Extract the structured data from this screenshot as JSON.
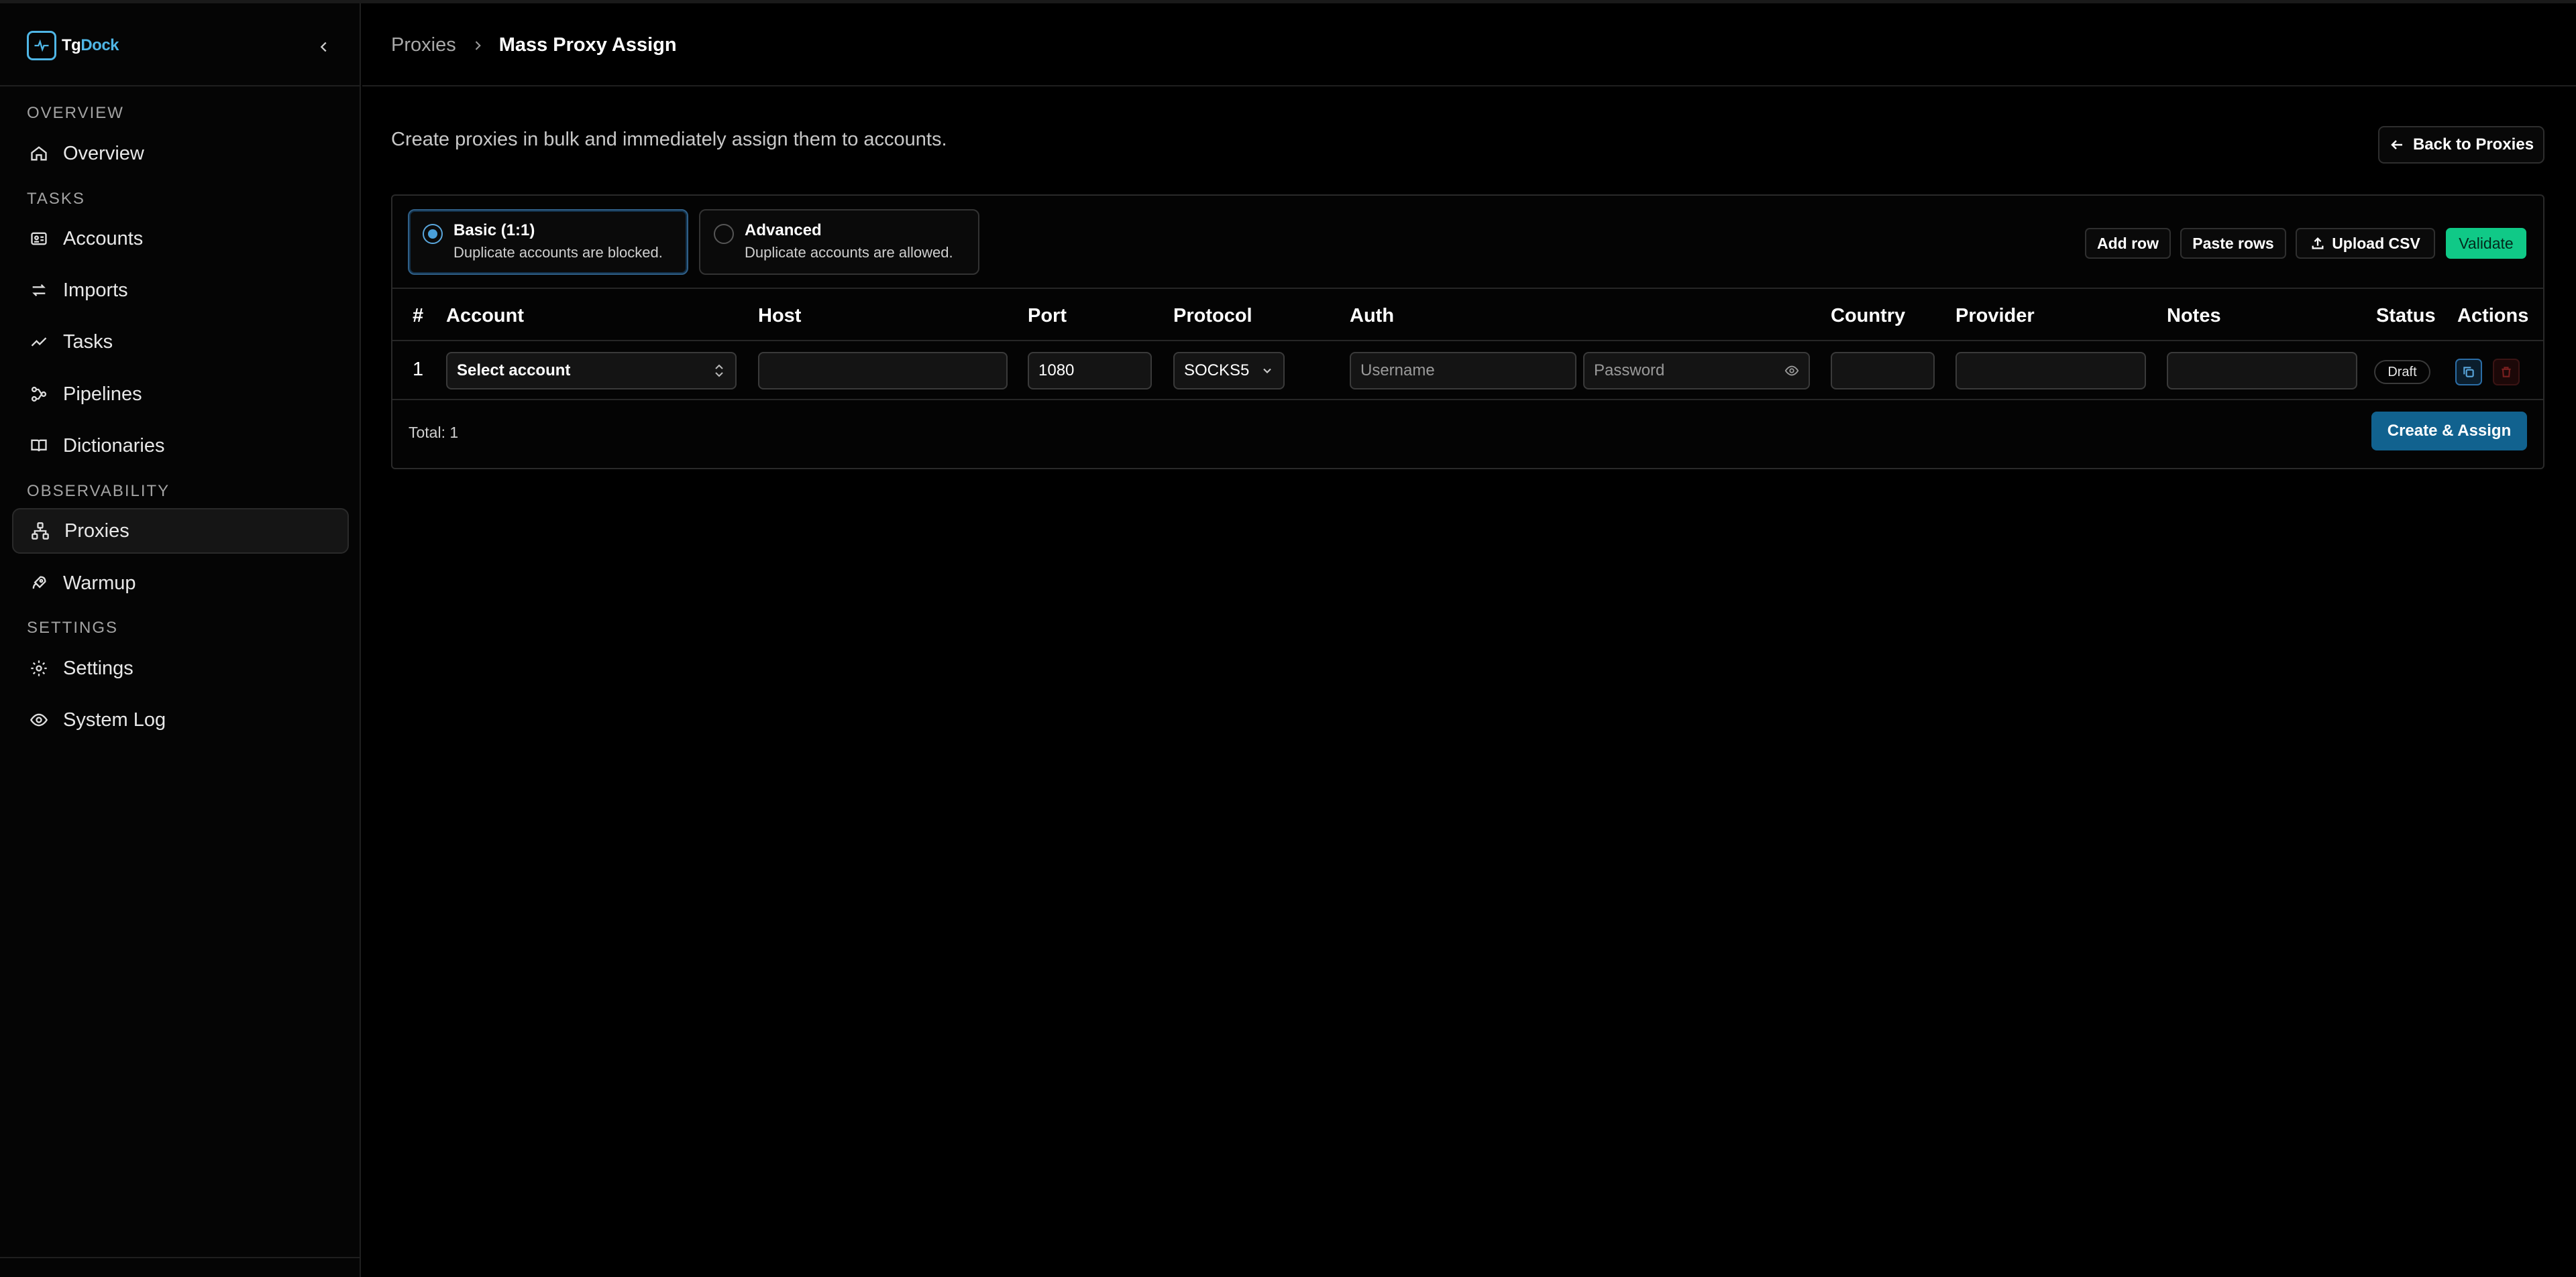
{
  "app": {
    "name_prefix": "Tg",
    "name_suffix": "Dock"
  },
  "sidebar": {
    "sections": {
      "overview": "OVERVIEW",
      "tasks": "TASKS",
      "observability": "OBSERVABILITY",
      "settings": "SETTINGS"
    },
    "items": [
      {
        "label": "Overview",
        "icon": "home-icon"
      },
      {
        "label": "Accounts",
        "icon": "id-card-icon"
      },
      {
        "label": "Imports",
        "icon": "swap-arrows-icon"
      },
      {
        "label": "Tasks",
        "icon": "activity-icon"
      },
      {
        "label": "Pipelines",
        "icon": "workflow-icon"
      },
      {
        "label": "Dictionaries",
        "icon": "book-icon"
      },
      {
        "label": "Proxies",
        "icon": "network-icon",
        "active": true
      },
      {
        "label": "Warmup",
        "icon": "rocket-icon"
      },
      {
        "label": "Settings",
        "icon": "gear-icon"
      },
      {
        "label": "System Log",
        "icon": "eye-icon"
      }
    ]
  },
  "header": {
    "breadcrumb": {
      "parent": "Proxies",
      "current": "Mass Proxy Assign"
    }
  },
  "page": {
    "subtitle": "Create proxies in bulk and immediately assign them to accounts.",
    "back_button": "Back to Proxies"
  },
  "modes": {
    "basic": {
      "title": "Basic (1:1)",
      "desc": "Duplicate accounts are blocked.",
      "selected": true
    },
    "advanced": {
      "title": "Advanced",
      "desc": "Duplicate accounts are allowed.",
      "selected": false
    }
  },
  "toolbar": {
    "add_row": "Add row",
    "paste_rows": "Paste rows",
    "upload_csv": "Upload CSV",
    "validate": "Validate"
  },
  "table": {
    "columns": [
      "#",
      "Account",
      "Host",
      "Port",
      "Protocol",
      "Auth",
      "Country",
      "Provider",
      "Notes",
      "Status",
      "Actions"
    ],
    "rows": [
      {
        "num": "1",
        "account": "Select account",
        "host": "",
        "port": "1080",
        "protocol": "SOCKS5",
        "username_placeholder": "Username",
        "password_placeholder": "Password",
        "country": "",
        "provider": "",
        "notes": "",
        "status": "Draft"
      }
    ]
  },
  "footer": {
    "total": "Total: 1",
    "create_button": "Create & Assign"
  },
  "colors": {
    "accent": "#4fb6e6",
    "validate": "#10c987",
    "primary": "#11628f",
    "danger": "#7a1f1f"
  }
}
